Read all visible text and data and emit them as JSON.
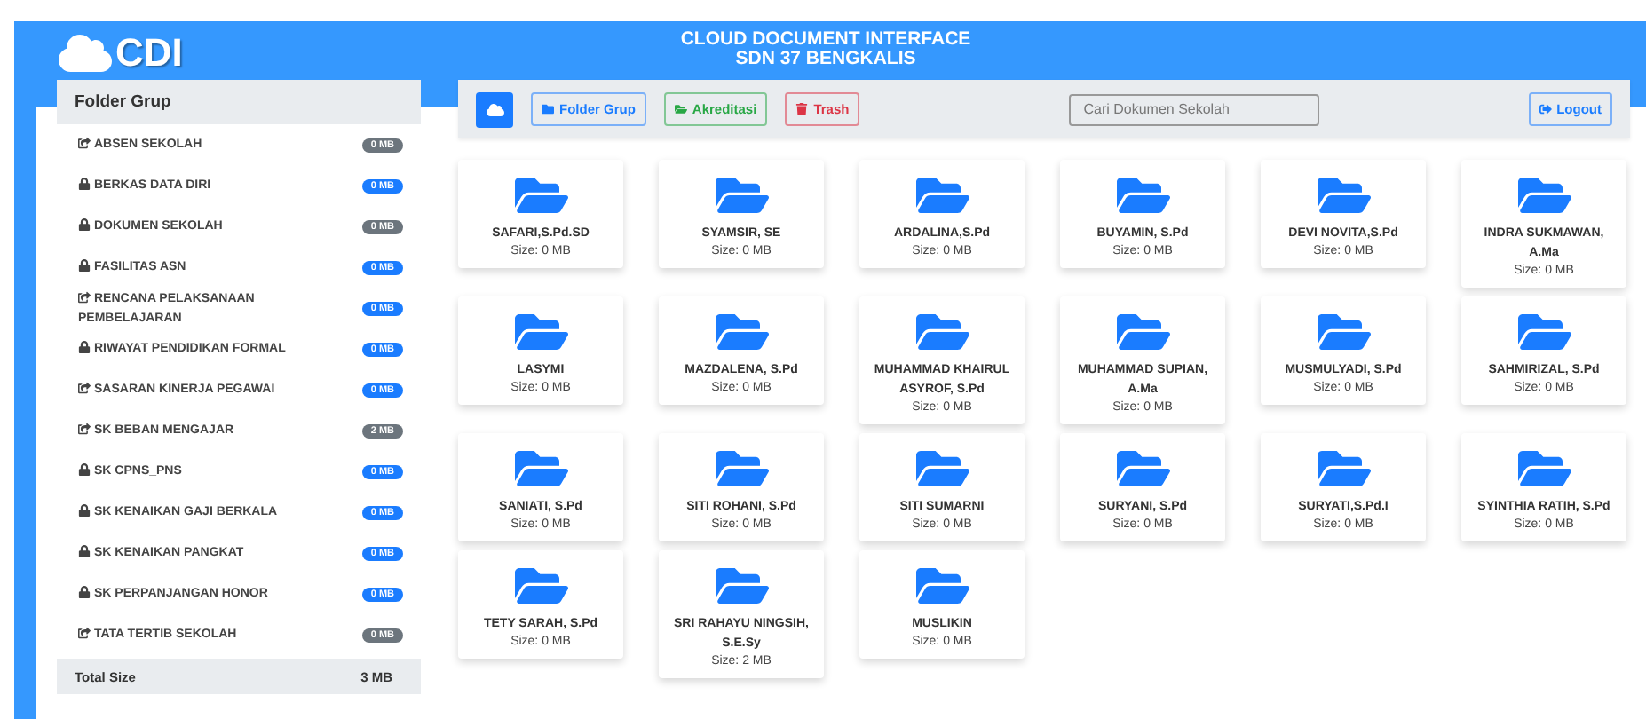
{
  "header": {
    "logo": "CDI",
    "title": "CLOUD DOCUMENT INTERFACE",
    "subtitle": "SDN 37 BENGKALIS"
  },
  "sidebar": {
    "title": "Folder Grup",
    "items": [
      {
        "label": "ABSEN SEKOLAH",
        "kind": "shared",
        "size": "0 MB",
        "color": "#6c757d"
      },
      {
        "label": "BERKAS DATA DIRI",
        "kind": "lock",
        "size": "0 MB",
        "color": "#1a7cff"
      },
      {
        "label": "DOKUMEN SEKOLAH",
        "kind": "lock",
        "size": "0 MB",
        "color": "#6c757d"
      },
      {
        "label": "FASILITAS ASN",
        "kind": "lock",
        "size": "0 MB",
        "color": "#1a7cff"
      },
      {
        "label": "RENCANA PELAKSANAAN PEMBELAJARAN",
        "kind": "shared",
        "size": "0 MB",
        "color": "#1a7cff"
      },
      {
        "label": "RIWAYAT PENDIDIKAN FORMAL",
        "kind": "lock",
        "size": "0 MB",
        "color": "#1a7cff"
      },
      {
        "label": "SASARAN KINERJA PEGAWAI",
        "kind": "shared",
        "size": "0 MB",
        "color": "#1a7cff"
      },
      {
        "label": "SK BEBAN MENGAJAR",
        "kind": "shared",
        "size": "2 MB",
        "color": "#6c757d"
      },
      {
        "label": "SK CPNS_PNS",
        "kind": "lock",
        "size": "0 MB",
        "color": "#1a7cff"
      },
      {
        "label": "SK KENAIKAN GAJI BERKALA",
        "kind": "lock",
        "size": "0 MB",
        "color": "#1a7cff"
      },
      {
        "label": "SK KENAIKAN PANGKAT",
        "kind": "lock",
        "size": "0 MB",
        "color": "#1a7cff"
      },
      {
        "label": "SK PERPANJANGAN HONOR",
        "kind": "lock",
        "size": "0 MB",
        "color": "#1a7cff"
      },
      {
        "label": "TATA TERTIB SEKOLAH",
        "kind": "shared",
        "size": "0 MB",
        "color": "#6c757d"
      }
    ],
    "total_label": "Total Size",
    "total_value": "3 MB"
  },
  "toolbar": {
    "buttons": [
      {
        "label": "Folder Grup",
        "kind": "folder"
      },
      {
        "label": "Akreditasi",
        "kind": "accreditation"
      },
      {
        "label": "Trash",
        "kind": "trash"
      }
    ],
    "search": {
      "placeholder": "Cari Dokumen Sekolah"
    },
    "logout": "Logout"
  },
  "folders": [
    {
      "name": "SAFARI,S.Pd.SD",
      "size": "Size: 0 MB"
    },
    {
      "name": "SYAMSIR, SE",
      "size": "Size: 0 MB"
    },
    {
      "name": "ARDALINA,S.Pd",
      "size": "Size: 0 MB"
    },
    {
      "name": "BUYAMIN, S.Pd",
      "size": "Size: 0 MB"
    },
    {
      "name": "DEVI NOVITA,S.Pd",
      "size": "Size: 0 MB"
    },
    {
      "name": "INDRA SUKMAWAN, A.Ma",
      "size": "Size: 0 MB"
    },
    {
      "name": "LASYMI",
      "size": "Size: 0 MB"
    },
    {
      "name": "MAZDALENA, S.Pd",
      "size": "Size: 0 MB"
    },
    {
      "name": "MUHAMMAD KHAIRUL ASYROF, S.Pd",
      "size": "Size: 0 MB"
    },
    {
      "name": "MUHAMMAD SUPIAN, A.Ma",
      "size": "Size: 0 MB"
    },
    {
      "name": "MUSMULYADI, S.Pd",
      "size": "Size: 0 MB"
    },
    {
      "name": "SAHMIRIZAL, S.Pd",
      "size": "Size: 0 MB"
    },
    {
      "name": "SANIATI, S.Pd",
      "size": "Size: 0 MB"
    },
    {
      "name": "SITI ROHANI, S.Pd",
      "size": "Size: 0 MB"
    },
    {
      "name": "SITI SUMARNI",
      "size": "Size: 0 MB"
    },
    {
      "name": "SURYANI, S.Pd",
      "size": "Size: 0 MB"
    },
    {
      "name": "SURYATI,S.Pd.I",
      "size": "Size: 0 MB"
    },
    {
      "name": "SYINTHIA RATIH, S.Pd",
      "size": "Size: 0 MB"
    },
    {
      "name": "TETY SARAH, S.Pd",
      "size": "Size: 0 MB"
    },
    {
      "name": "SRI RAHAYU NINGSIH, S.E.Sy",
      "size": "Size: 2 MB"
    },
    {
      "name": "MUSLIKIN",
      "size": "Size: 0 MB"
    }
  ]
}
